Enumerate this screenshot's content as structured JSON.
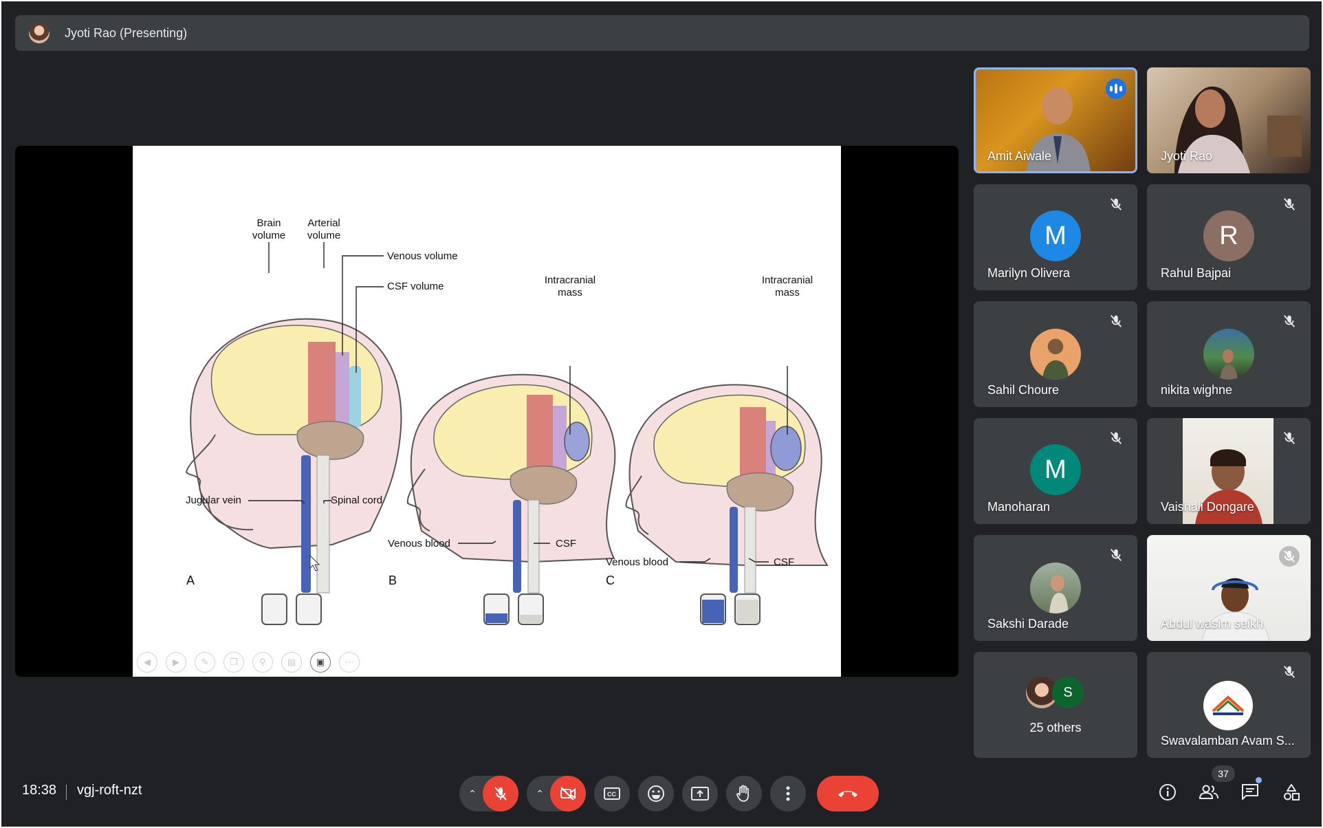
{
  "presenter": {
    "name": "Jyoti Rao (Presenting)"
  },
  "slide": {
    "labels": {
      "brain_volume": [
        "Brain",
        "volume"
      ],
      "arterial_volume": [
        "Arterial",
        "volume"
      ],
      "venous_volume": "Venous volume",
      "csf_volume": "CSF volume",
      "intracranial_mass": [
        "Intracranial",
        "mass"
      ],
      "jugular_vein": "Jugular vein",
      "spinal_cord": "Spinal cord",
      "venous_blood": "Venous blood",
      "csf": "CSF",
      "panel_a": "A",
      "panel_b": "B",
      "panel_c": "C"
    },
    "toolbar": [
      "prev-icon",
      "next-icon",
      "pen-icon",
      "copy-icon",
      "zoom-icon",
      "subtitles-icon",
      "video-icon",
      "more-icon"
    ]
  },
  "participants": [
    {
      "name": "Amit Aiwale",
      "speaking": true,
      "kind": "video"
    },
    {
      "name": "Jyoti Rao",
      "kind": "video"
    },
    {
      "name": "Marilyn Olivera",
      "initial": "M",
      "color": "#1e88e5",
      "muted": true
    },
    {
      "name": "Rahul Bajpai",
      "initial": "R",
      "color": "#8d6e63",
      "muted": true
    },
    {
      "name": "Sahil Choure",
      "kind": "photo",
      "muted": true
    },
    {
      "name": "nikita wighne",
      "kind": "photo",
      "muted": true
    },
    {
      "name": "Manoharan",
      "initial": "M",
      "color": "#00897b",
      "muted": true
    },
    {
      "name": "Vaishali Dongare",
      "kind": "video",
      "muted": true
    },
    {
      "name": "Sakshi Darade",
      "kind": "photo",
      "muted": true
    },
    {
      "name": "Abdul wasim seikh",
      "kind": "video",
      "muted": true
    },
    {
      "name": "25 others",
      "avatar_letter": "S",
      "avatar_color": "#0d652d"
    },
    {
      "name": "Swavalamban Avam S...",
      "kind": "logo",
      "muted": true
    }
  ],
  "bottom_bar": {
    "time": "18:38",
    "meeting_code": "vgj-roft-nzt",
    "people_count": "37",
    "controls": [
      "mic-options-chevron",
      "mic-off-button",
      "camera-options-chevron",
      "camera-off-button",
      "captions-button",
      "emoji-button",
      "present-button",
      "raise-hand-button",
      "more-options-button",
      "leave-call-button"
    ],
    "right_icons": [
      "info-icon",
      "people-icon",
      "chat-icon",
      "activities-icon"
    ]
  }
}
